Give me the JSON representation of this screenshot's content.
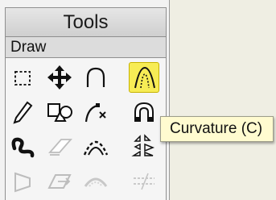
{
  "panel": {
    "title": "Tools",
    "section": "Draw"
  },
  "tools": [
    {
      "name": "select-rect-icon",
      "enabled": true
    },
    {
      "name": "move-icon",
      "enabled": true
    },
    {
      "name": "arc-icon",
      "enabled": true
    },
    {
      "name": "curvature-icon",
      "enabled": true,
      "active": true
    },
    {
      "name": "pencil-icon",
      "enabled": true
    },
    {
      "name": "shapes-icon",
      "enabled": true
    },
    {
      "name": "bezier-icon",
      "enabled": true
    },
    {
      "name": "magnet-icon",
      "enabled": true
    },
    {
      "name": "freehand-curve-icon",
      "enabled": true
    },
    {
      "name": "eraser-icon",
      "enabled": false
    },
    {
      "name": "dashed-arc-icon",
      "enabled": true
    },
    {
      "name": "triangles-icon",
      "enabled": true
    },
    {
      "name": "shape-outline-icon",
      "enabled": false
    },
    {
      "name": "skew-icon",
      "enabled": false
    },
    {
      "name": "arc-dotted-icon",
      "enabled": false
    },
    {
      "name": "dashed-line-icon",
      "enabled": false
    }
  ],
  "tooltip": {
    "text": "Curvature (C)"
  }
}
